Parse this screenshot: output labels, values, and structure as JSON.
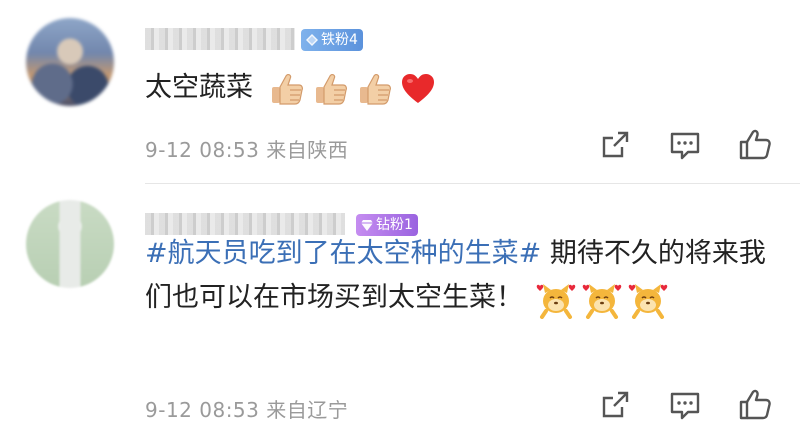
{
  "comments": [
    {
      "badge": "铁粉4",
      "badge_icon": "diamond-icon",
      "text": "太空蔬菜",
      "emojis": [
        "thumbs-up-icon",
        "thumbs-up-icon",
        "thumbs-up-icon",
        "red-heart-icon"
      ],
      "time": "9-12 08:53",
      "location": "来自陕西"
    },
    {
      "badge": "钻粉1",
      "badge_icon": "diamond-icon",
      "hashtag": "#航天员吃到了在太空种的生菜#",
      "text": " 期待不久的将来我们也可以在市场买到太空生菜！",
      "emojis": [
        "doge-heart-icon",
        "doge-heart-icon",
        "doge-heart-icon"
      ],
      "time": "9-12 08:53",
      "location": "来自辽宁"
    }
  ],
  "actions": [
    "share-icon",
    "comment-icon",
    "like-icon"
  ],
  "colors": {
    "text": "#222222",
    "meta": "#9a9a9a",
    "hashtag": "#3b6fb6",
    "badge_blue": "#6aa3e6",
    "badge_purple": "#b078ea"
  }
}
